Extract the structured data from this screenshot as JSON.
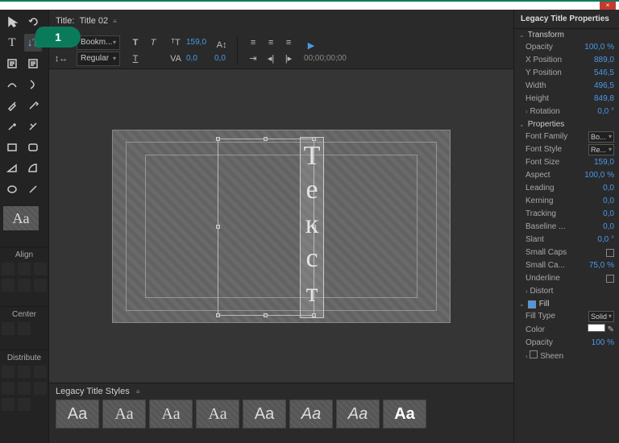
{
  "window": {
    "close": "×"
  },
  "callout": "1",
  "title_bar": {
    "label": "Title:",
    "name": "Title 02"
  },
  "controls": {
    "font_family": "Bookm...",
    "font_style": "Regular",
    "size_label": "T",
    "size_value": "159,0",
    "kerning_icon": "VA",
    "kerning_value": "0,0",
    "leading_value": "0,0",
    "timecode": "00;00;00;00"
  },
  "tools_sections": {
    "align": "Align",
    "center": "Center",
    "distribute": "Distribute"
  },
  "canvas_text": [
    "Т",
    "е",
    "к",
    "с",
    "т"
  ],
  "styles": {
    "title": "Legacy Title Styles",
    "sample": "Aa"
  },
  "panel_title": "Legacy Title Properties",
  "sections": {
    "transform": "Transform",
    "properties": "Properties",
    "fill": "Fill"
  },
  "transform": {
    "opacity_lbl": "Opacity",
    "opacity_val": "100,0 %",
    "xpos_lbl": "X Position",
    "xpos_val": "889,0",
    "ypos_lbl": "Y Position",
    "ypos_val": "546,5",
    "width_lbl": "Width",
    "width_val": "496,5",
    "height_lbl": "Height",
    "height_val": "849,8",
    "rotation_lbl": "Rotation",
    "rotation_val": "0,0 °"
  },
  "properties": {
    "fontfamily_lbl": "Font Family",
    "fontfamily_val": "Bo...",
    "fontstyle_lbl": "Font Style",
    "fontstyle_val": "Re...",
    "fontsize_lbl": "Font Size",
    "fontsize_val": "159,0",
    "aspect_lbl": "Aspect",
    "aspect_val": "100,0 %",
    "leading_lbl": "Leading",
    "leading_val": "0,0",
    "kerning_lbl": "Kerning",
    "kerning_val": "0,0",
    "tracking_lbl": "Tracking",
    "tracking_val": "0,0",
    "baseline_lbl": "Baseline ...",
    "baseline_val": "0,0",
    "slant_lbl": "Slant",
    "slant_val": "0,0 °",
    "smallcaps_lbl": "Small Caps",
    "smallcapssize_lbl": "Small Ca...",
    "smallcapssize_val": "75,0 %",
    "underline_lbl": "Underline",
    "distort_lbl": "Distort"
  },
  "fill": {
    "filltype_lbl": "Fill Type",
    "filltype_val": "Solid",
    "color_lbl": "Color",
    "opacity_lbl": "Opacity",
    "opacity_val": "100 %",
    "sheen_lbl": "Sheen"
  },
  "preview_sample": "Aa"
}
